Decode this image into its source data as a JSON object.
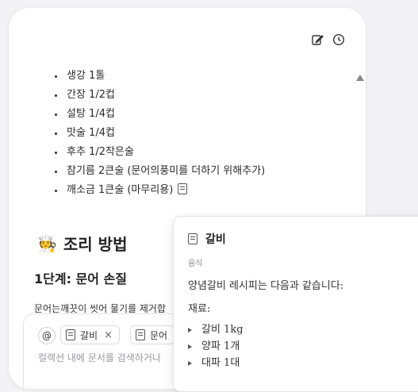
{
  "toolbar": {
    "edit_icon": "edit-icon",
    "history_icon": "clock-icon"
  },
  "ingredients": [
    "생강 1톨",
    "간장 1/2컵",
    "설탕 1/4컵",
    "맛술 1/4컵",
    "후추 1/2작은술",
    "참기름 2큰술 (문어의풍미를 더하기 위해추가)",
    "깨소금 1큰술 (마무리용)"
  ],
  "section": {
    "emoji": "🧑‍🍳",
    "title": "조리 방법"
  },
  "step": {
    "title": "1단계: 문어 손질",
    "text": "문어는깨끗이 씻어 물기를 제거합"
  },
  "composer": {
    "at_label": "@",
    "chips": [
      {
        "label": "갈비",
        "close": "×"
      },
      {
        "label": "문어"
      }
    ],
    "placeholder": "컬렉션 내에 문서를 검색하거나"
  },
  "popup": {
    "title": "갈비",
    "category": "음식",
    "description": "양념갈비 레시피는 다음과 같습니다:",
    "ingredients_label": "재료:",
    "items": [
      "갈비 1kg",
      "양파 1개",
      "대파 1대"
    ]
  },
  "colors": {
    "background": "#f3f3f5",
    "panel": "#ffffff",
    "text": "#1f1f1f",
    "muted": "#888888"
  }
}
